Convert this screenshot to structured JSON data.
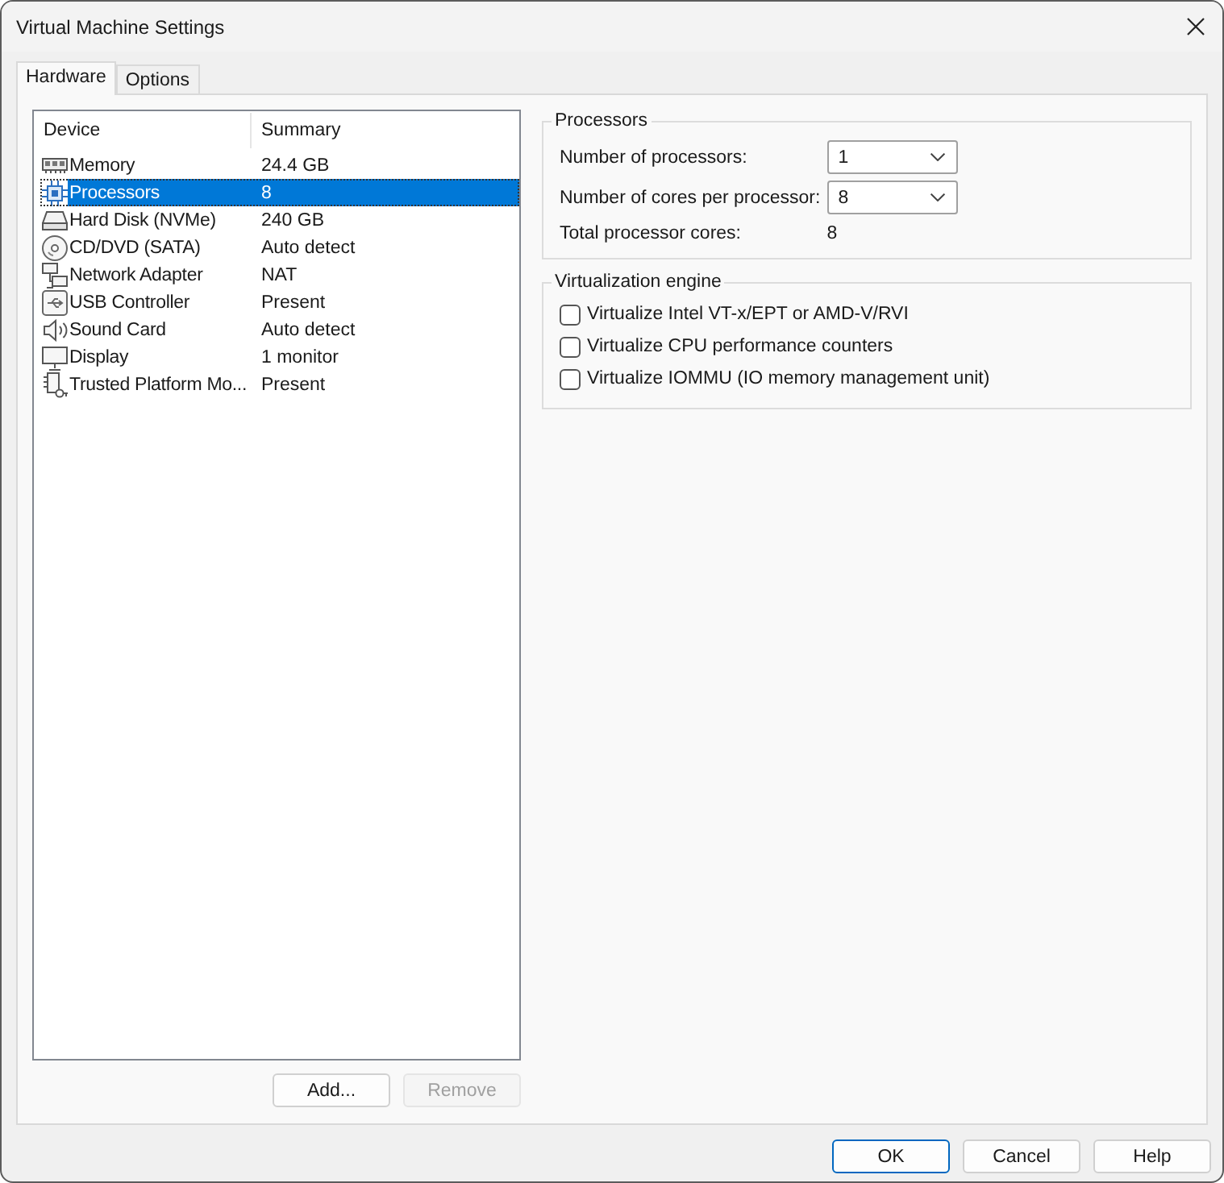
{
  "window": {
    "title": "Virtual Machine Settings"
  },
  "tabs": [
    {
      "label": "Hardware",
      "selected": true
    },
    {
      "label": "Options",
      "selected": false
    }
  ],
  "device_list": {
    "columns": [
      "Device",
      "Summary"
    ],
    "rows": [
      {
        "kind": "memory",
        "device": "Memory",
        "summary": "24.4 GB",
        "selected": false
      },
      {
        "kind": "processor",
        "device": "Processors",
        "summary": "8",
        "selected": true
      },
      {
        "kind": "disk",
        "device": "Hard Disk (NVMe)",
        "summary": "240 GB",
        "selected": false
      },
      {
        "kind": "cdrom",
        "device": "CD/DVD (SATA)",
        "summary": "Auto detect",
        "selected": false
      },
      {
        "kind": "network",
        "device": "Network Adapter",
        "summary": "NAT",
        "selected": false
      },
      {
        "kind": "usb",
        "device": "USB Controller",
        "summary": "Present",
        "selected": false
      },
      {
        "kind": "sound",
        "device": "Sound Card",
        "summary": "Auto detect",
        "selected": false
      },
      {
        "kind": "display",
        "device": "Display",
        "summary": "1 monitor",
        "selected": false
      },
      {
        "kind": "tpm",
        "device": "Trusted Platform Mo...",
        "summary": "Present",
        "selected": false
      }
    ]
  },
  "list_buttons": [
    {
      "label": "Add...",
      "disabled": false
    },
    {
      "label": "Remove",
      "disabled": true
    }
  ],
  "processors": {
    "title": "Processors",
    "fields": [
      {
        "kind": "select",
        "label": "Number of processors:",
        "value": "1"
      },
      {
        "kind": "select",
        "label": "Number of cores per processor:",
        "value": "8"
      },
      {
        "kind": "text",
        "label": "Total processor cores:",
        "value": "8"
      }
    ]
  },
  "virtualization": {
    "title": "Virtualization engine",
    "options": [
      {
        "label": "Virtualize Intel VT-x/EPT or AMD-V/RVI",
        "checked": false
      },
      {
        "label": "Virtualize CPU performance counters",
        "checked": false
      },
      {
        "label": "Virtualize IOMMU (IO memory management unit)",
        "checked": false
      }
    ]
  },
  "buttons": [
    {
      "label": "OK",
      "default": true
    },
    {
      "label": "Cancel",
      "default": false
    },
    {
      "label": "Help",
      "default": false
    }
  ]
}
